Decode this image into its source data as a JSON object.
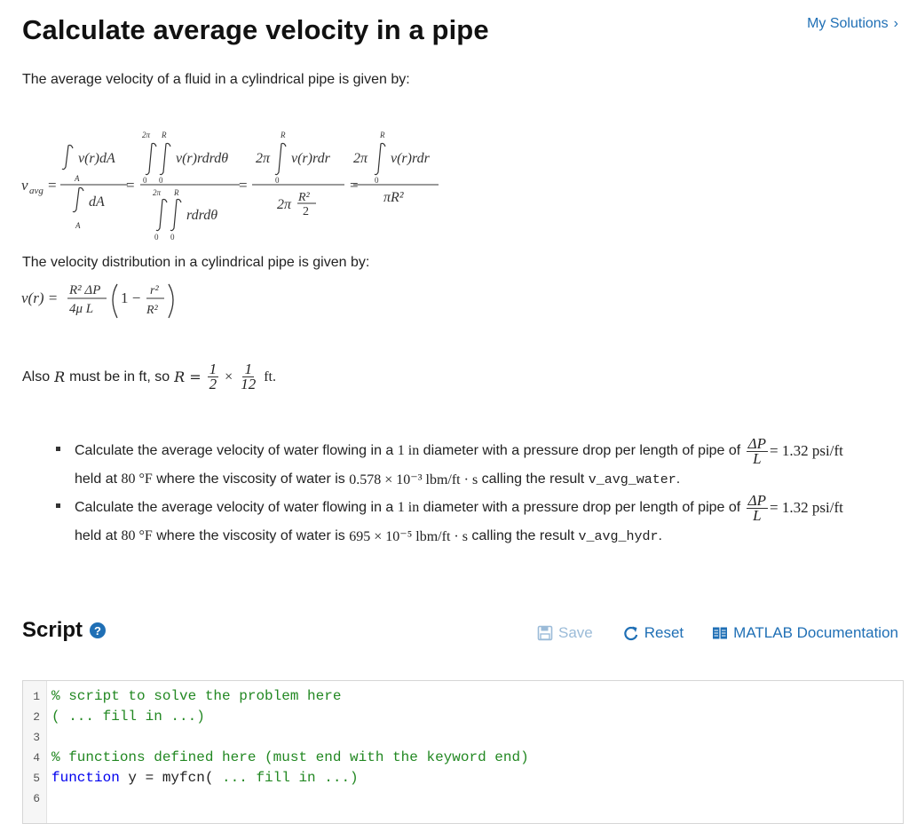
{
  "header": {
    "title": "Calculate average velocity in a pipe",
    "my_solutions": "My Solutions",
    "my_solutions_chevron": "›"
  },
  "intro": "The average velocity of a fluid in a cylindrical pipe is given by:",
  "equation_avg": {
    "lhs": "v",
    "lhs_sub": "avg",
    "int_dA_num": "v(r)dA",
    "int_dA_den": "dA",
    "region_label": "A",
    "double_num": "v(r)rdrdθ",
    "double_den": "rdrdθ",
    "limit_two_pi": "2π",
    "limit_R": "R",
    "limit_zero": "0",
    "two_pi": "2π",
    "single_num": "v(r)rdr",
    "den_R2_over_2_num": "R²",
    "den_R2_over_2_den": "2",
    "final_den": "πR²",
    "equals": "="
  },
  "velocity_intro": "The velocity distribution in a cylindrical pipe is given by:",
  "equation_velocity": {
    "lhs": "v(r) =",
    "f1_num": "R² ΔP",
    "f1_den": "4μ L",
    "inner": "1 −",
    "f2_num": "r²",
    "f2_den": "R²"
  },
  "also": {
    "prefix": "Also",
    "var": "R",
    "mid": "must be in ft, so",
    "lhs": "R =",
    "f1_num": "1",
    "f1_den": "2",
    "times": "×",
    "f2_num": "1",
    "f2_den": "12",
    "unit": "ft."
  },
  "tasks": [
    {
      "a": "Calculate the average velocity of water flowing in a",
      "d": "1 in",
      "b": "diameter with a pressure drop per length of pipe of",
      "frac_num": "ΔP",
      "frac_den": "L",
      "grad": "= 1.32 psi/ft",
      "c": "held at",
      "temp": "80 °F",
      "e": "where the viscosity of water is",
      "visc": "0.578 × 10⁻³ lbm/ft · s",
      "f": "calling the result",
      "var": "v_avg_water",
      "g": "."
    },
    {
      "a": "Calculate the average velocity of water flowing in a",
      "d": "1 in",
      "b": "diameter with a pressure drop per length of pipe of",
      "frac_num": "ΔP",
      "frac_den": "L",
      "grad": "= 1.32 psi/ft",
      "c": "held at",
      "temp": "80 °F",
      "e": "where the viscosity of water is",
      "visc": "695 × 10⁻⁵ lbm/ft · s",
      "f": "calling the result",
      "var": "v_avg_hydr",
      "g": "."
    }
  ],
  "script_section": {
    "title": "Script",
    "help_icon": "?",
    "save": "Save",
    "reset": "Reset",
    "docs": "MATLAB Documentation"
  },
  "editor": {
    "line_numbers": [
      "1",
      "2",
      "3",
      "4",
      "5",
      "6"
    ],
    "line1": "% script to solve the problem here",
    "line2": "( ... fill in ...)",
    "line4": "% functions defined here (must end with the keyword end)",
    "line5_kw": "function",
    "line5_mid": " y = myfcn( ",
    "line5_cmt": "... fill in ...)"
  },
  "colors": {
    "link": "#1f6fb5",
    "save_disabled": "#9bbbd8",
    "code_comment": "#228822",
    "code_keyword": "#0000ee"
  }
}
